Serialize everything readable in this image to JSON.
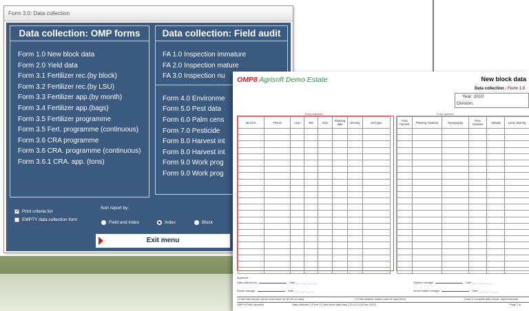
{
  "window": {
    "title": "Form 3.0: Data collection"
  },
  "omp_forms": {
    "heading": "Data collection: OMP forms",
    "items": [
      "Form 1.0  New block data",
      "Form 2.0  Yield data",
      "Form 3.1  Fertilizer rec.(by block)",
      "Form 3.2  Fertilizer rec.(by LSU)",
      "Form 3.3  Fertilizer app.(by month)",
      "Form 3.4  Fertilizer app.(bags)",
      "Form 3.5  Fertilizer programme",
      "Form 3.5  Fert. programme (continuous)",
      "Form 3.6  CRA programme",
      "Form 3.6  CRA. programme (continuous)",
      "Form 3.6.1  CRA. app. (tons)"
    ]
  },
  "field_audit": {
    "heading": "Data collection: Field audit",
    "items_top": [
      "FA 1.0  Inspection immature",
      "FA 2.0  Inspection mature",
      "FA 3.0  Inspection nu"
    ],
    "items_bottom": [
      "Form 4.0  Environme",
      "Form 5.0  Pest data",
      "Form 6.0  Palm cens",
      "Form 7.0  Pesticide",
      "Form 8.0  Harvest int",
      "Form 8.0  Harvest int",
      "Form 9.0  Work prog",
      "Form 9.0  Work prog"
    ]
  },
  "options": {
    "print_criteria": "Print criteria list",
    "print_criteria_checked": true,
    "empty_form": "EMPTY data collection form",
    "empty_form_checked": false,
    "sort_label": "Sort report by:",
    "sort_options": [
      "Field and index",
      "Index",
      "Block"
    ],
    "sort_selected": "Index"
  },
  "exit_label": "Exit menu",
  "report": {
    "logo_main": "OMP8",
    "logo_sub": "Agrisoft Demo Estate",
    "title": "New block data",
    "subtitle_prefix": "Data collection : ",
    "subtitle_form": "Form 1.0",
    "year": "Year:  2010",
    "division": "Division:",
    "entry_required": "Entry required",
    "entry_optional": "Entry optional",
    "left_headers": [
      "BLOCK",
      "FIELD",
      "LSU",
      "WS",
      "Size",
      "Planting date",
      "Density",
      "Soil type"
    ],
    "right_headers": [
      "First harvest",
      "Planting material",
      "Topography",
      "Prev. landuse",
      "Altitude",
      "Land clearing"
    ],
    "row_count": 23,
    "approved": "Approved :",
    "collected_by": "Data collected by",
    "estate_manager": "Estate manager",
    "division_manager": "Division manager",
    "senior_estate_manager": "Senior estate manager",
    "date": "Date",
    "date_blank": "_ _ - _ _ - _ _ _ _",
    "note_1": "1 Enter leaf sample unit for each block (or NS for no data)",
    "note_2": "2 Enter weather station code for each block",
    "note_3": "3 and 4 Complete date format: day/month/year",
    "footer_app": "OMP+8 Field Upsweep",
    "footer_form": "Data collection 1 Form 1.0 New block data  Map 2.01 21.1 (14 Dec 2010)",
    "footer_page": "Page 1 of"
  },
  "colors": {
    "panel_bg": "#3b5a7f",
    "accent_red": "#d42020",
    "logo_green": "#2b9a3c"
  }
}
